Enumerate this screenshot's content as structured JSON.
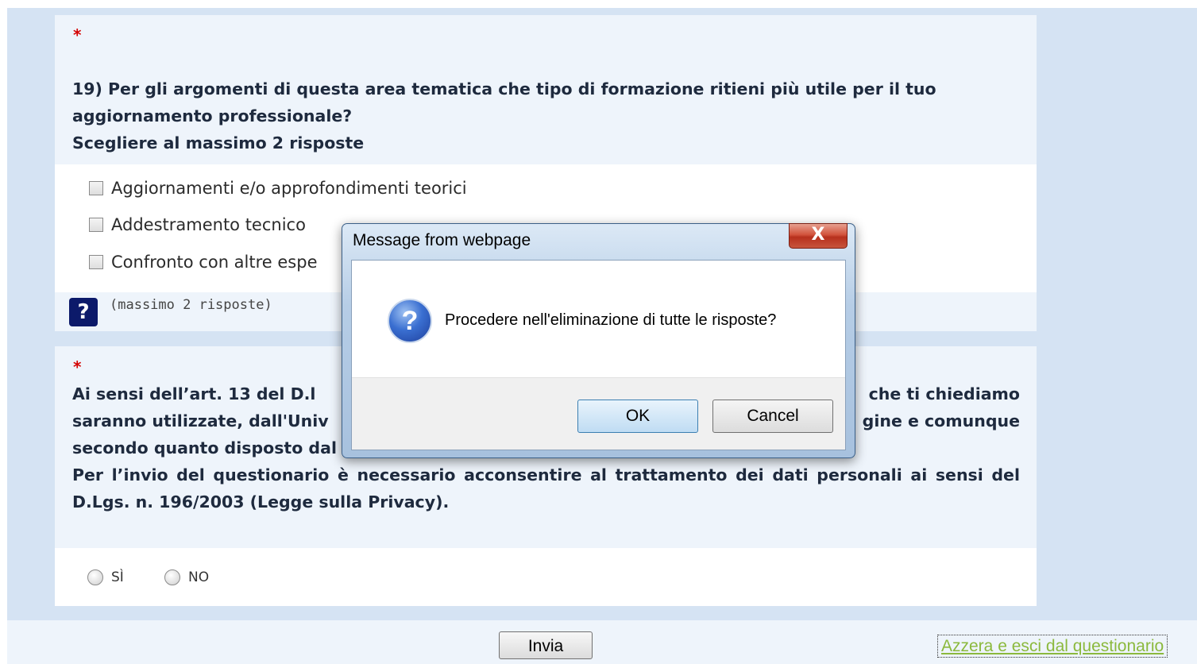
{
  "question": {
    "required_mark": "*",
    "text_line1": "19) Per gli argomenti di questa area tematica che tipo di formazione ritieni più utile per il tuo",
    "text_line2": "aggiornamento professionale?",
    "instruction": "Scegliere al massimo 2 risposte",
    "options": [
      {
        "label": "Aggiornamenti e/o approfondimenti teorici",
        "checked": false
      },
      {
        "label": "Addestramento tecnico",
        "checked": false
      },
      {
        "label": "Confronto con altre espe",
        "checked": false
      }
    ],
    "help_icon": "?",
    "hint": "(massimo 2 risposte)"
  },
  "privacy": {
    "required_mark": "*",
    "line1_left": "Ai sensi dell’art. 13 del D.l",
    "line1_right": "che ti chiediamo",
    "line2_left": "saranno utilizzate, dall'Univ",
    "line2_right": "gine e comunque",
    "line3_left": "secondo quanto disposto dal",
    "paragraph2": "Per l’invio del questionario è necessario acconsentire al trattamento dei dati personali ai sensi del D.Lgs. n. 196/2003 (Legge sulla Privacy).",
    "radio_options": [
      {
        "label": "SÌ",
        "selected": false
      },
      {
        "label": "NO",
        "selected": false
      }
    ]
  },
  "footer": {
    "submit_label": "Invia",
    "reset_link_label": "Azzera e esci dal questionario"
  },
  "dialog": {
    "title": "Message from webpage",
    "close_glyph": "X",
    "question_icon": "?",
    "message": "Procedere nell'eliminazione di tutte le risposte?",
    "ok_label": "OK",
    "cancel_label": "Cancel"
  }
}
